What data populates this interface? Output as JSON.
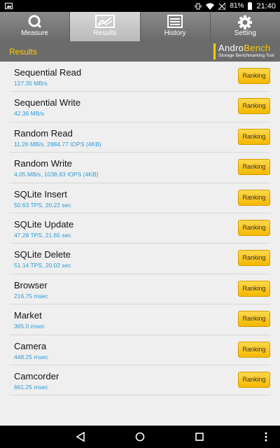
{
  "status_bar": {
    "battery": "81%",
    "time": "21:40"
  },
  "tabs": [
    {
      "label": "Measure",
      "icon": "magnifier-icon",
      "active": false
    },
    {
      "label": "Results",
      "icon": "chart-icon",
      "active": true
    },
    {
      "label": "History",
      "icon": "list-icon",
      "active": false
    },
    {
      "label": "Setting",
      "icon": "gear-icon",
      "active": false
    }
  ],
  "header": {
    "title": "Results",
    "logo_name_a": "Andro",
    "logo_name_b": "Bench",
    "logo_tagline": "Storage Benchmarking Tool"
  },
  "results": [
    {
      "title": "Sequential Read",
      "value": "127.35 MB/s",
      "button": "Ranking"
    },
    {
      "title": "Sequential Write",
      "value": "42.36 MB/s",
      "button": "Ranking"
    },
    {
      "title": "Random Read",
      "value": "11.26 MB/s, 2884.77 IOPS (4KB)",
      "button": "Ranking"
    },
    {
      "title": "Random Write",
      "value": "4.05 MB/s, 1038.83 IOPS (4KB)",
      "button": "Ranking"
    },
    {
      "title": "SQLite Insert",
      "value": "50.63 TPS, 20.22 sec",
      "button": "Ranking"
    },
    {
      "title": "SQLite Update",
      "value": "47.28 TPS, 21.65 sec",
      "button": "Ranking"
    },
    {
      "title": "SQLite Delete",
      "value": "51.14 TPS, 20.02 sec",
      "button": "Ranking"
    },
    {
      "title": "Browser",
      "value": "216.75 msec",
      "button": "Ranking"
    },
    {
      "title": "Market",
      "value": "365.0 msec",
      "button": "Ranking"
    },
    {
      "title": "Camera",
      "value": "448.25 msec",
      "button": "Ranking"
    },
    {
      "title": "Camcorder",
      "value": "661.25 msec",
      "button": "Ranking"
    }
  ],
  "colors": {
    "accent": "#ffcc00",
    "value_text": "#2a9bd8",
    "button": "#f5c400"
  }
}
